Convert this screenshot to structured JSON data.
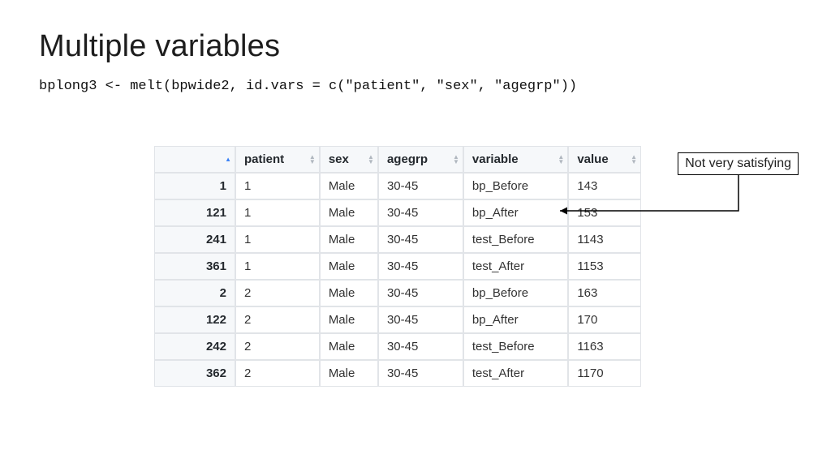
{
  "title": "Multiple variables",
  "code": "bplong3 <- melt(bpwide2, id.vars = c(\"patient\", \"sex\", \"agegrp\"))",
  "callout": "Not very satisfying",
  "table": {
    "headers": [
      "patient",
      "sex",
      "agegrp",
      "variable",
      "value"
    ],
    "rows": [
      {
        "rn": "1",
        "patient": "1",
        "sex": "Male",
        "agegrp": "30-45",
        "variable": "bp_Before",
        "value": "143"
      },
      {
        "rn": "121",
        "patient": "1",
        "sex": "Male",
        "agegrp": "30-45",
        "variable": "bp_After",
        "value": "153"
      },
      {
        "rn": "241",
        "patient": "1",
        "sex": "Male",
        "agegrp": "30-45",
        "variable": "test_Before",
        "value": "1143"
      },
      {
        "rn": "361",
        "patient": "1",
        "sex": "Male",
        "agegrp": "30-45",
        "variable": "test_After",
        "value": "1153"
      },
      {
        "rn": "2",
        "patient": "2",
        "sex": "Male",
        "agegrp": "30-45",
        "variable": "bp_Before",
        "value": "163"
      },
      {
        "rn": "122",
        "patient": "2",
        "sex": "Male",
        "agegrp": "30-45",
        "variable": "bp_After",
        "value": "170"
      },
      {
        "rn": "242",
        "patient": "2",
        "sex": "Male",
        "agegrp": "30-45",
        "variable": "test_Before",
        "value": "1163"
      },
      {
        "rn": "362",
        "patient": "2",
        "sex": "Male",
        "agegrp": "30-45",
        "variable": "test_After",
        "value": "1170"
      }
    ]
  }
}
